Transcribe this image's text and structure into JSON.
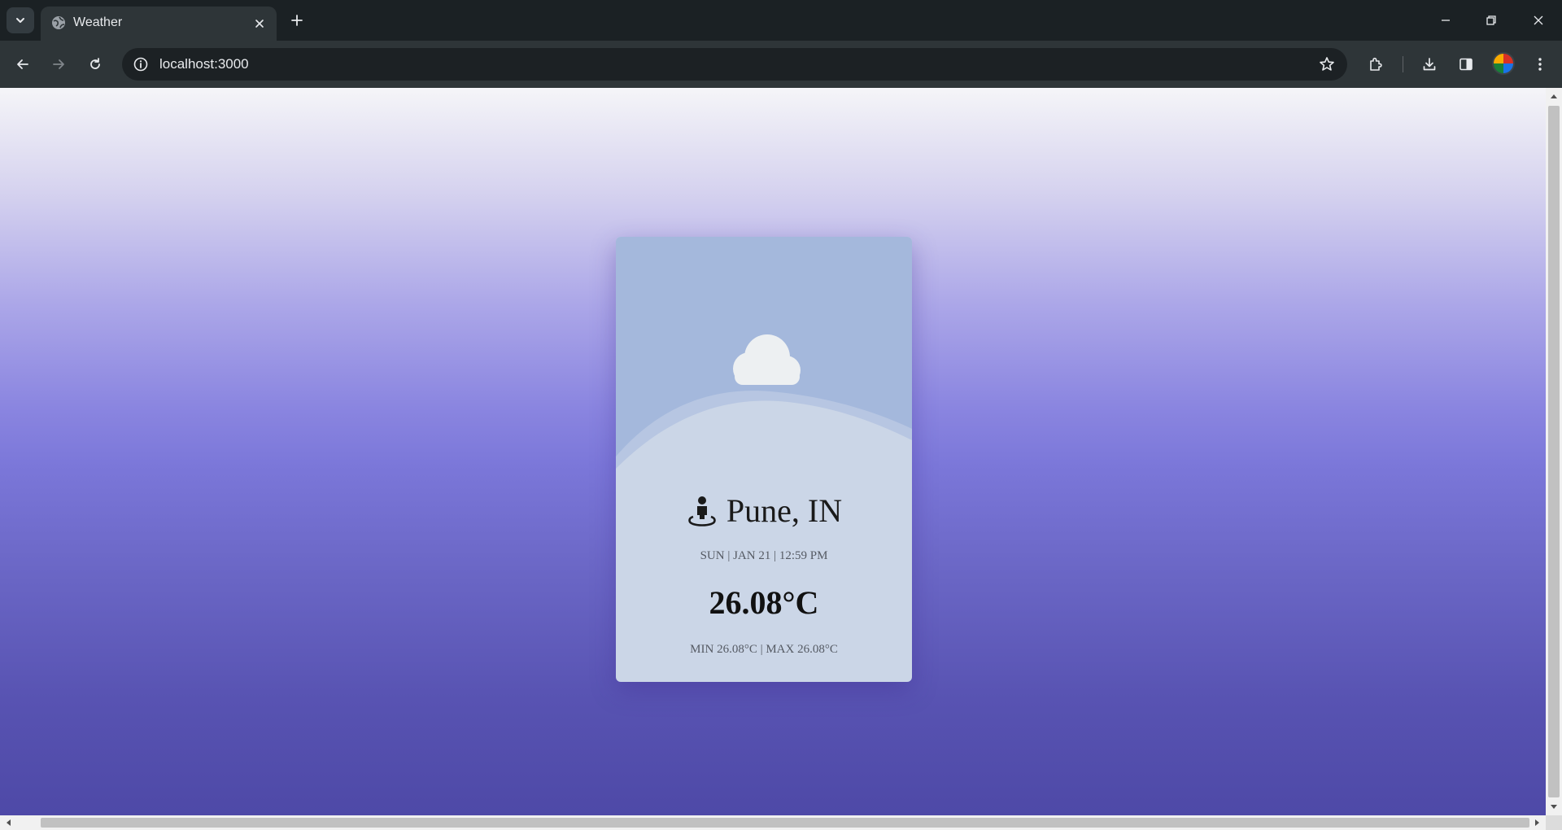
{
  "browser": {
    "tab": {
      "title": "Weather",
      "favicon": "globe-icon"
    },
    "address_bar": {
      "url": "localhost:3000"
    },
    "colors": {
      "titlebar": "#1b2124",
      "toolbar": "#2e3538",
      "omnibox": "#1c2124"
    }
  },
  "weather": {
    "condition_icon": "cloud-icon",
    "location_icon": "location-person-icon",
    "location": "Pune, IN",
    "datetime": "SUN | JAN 21 | 12:59 PM",
    "temperature": "26.08°C",
    "minmax": "MIN 26.08°C | MAX 26.08°C",
    "colors": {
      "card_top": "#a4b8dc",
      "card_bottom": "#cbd6e7",
      "cloud": "#edf0f2",
      "page_gradient_top": "#f5f5f8",
      "page_gradient_bottom": "#4e49a7"
    }
  }
}
